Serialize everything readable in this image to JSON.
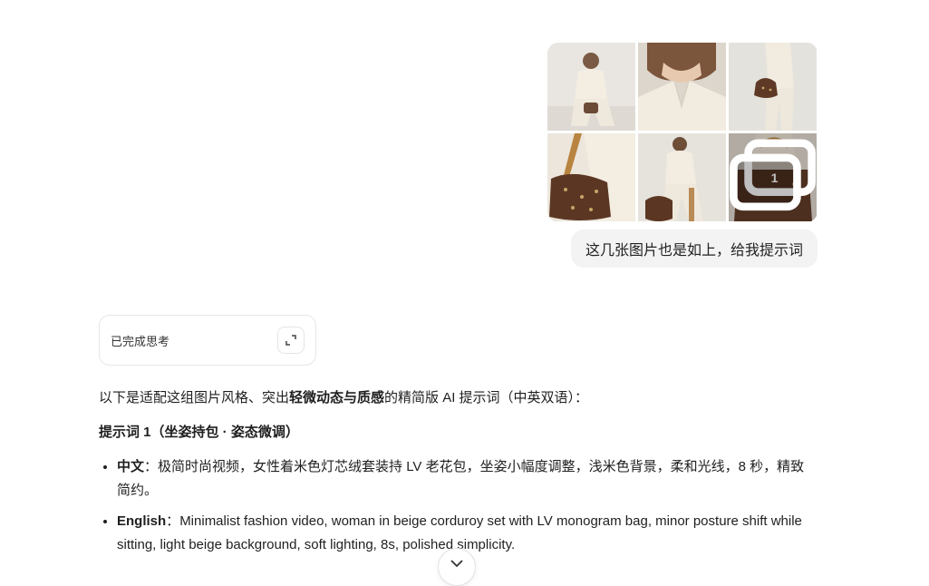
{
  "conversation": {
    "user_message": {
      "images": [
        {
          "icon": "photo-woman-seated-with-bag"
        },
        {
          "icon": "photo-closeup-collar"
        },
        {
          "icon": "photo-bag-on-shoulder"
        },
        {
          "icon": "photo-monogram-bag-closeup"
        },
        {
          "icon": "photo-woman-seated-full"
        },
        {
          "icon": "photo-bag-handles",
          "more_count": "1",
          "more_icon": "gallery-stack-icon"
        }
      ],
      "text": "这几张图片也是如上，给我提示词"
    },
    "thinking": {
      "label": "已完成思考",
      "expand_icon": "expand-icon"
    },
    "answer": {
      "intro_before": "以下是适配这组图片风格、突出",
      "intro_bold": "轻微动态与质感",
      "intro_after": "的精简版 AI 提示词（中英双语）：",
      "heading": "提示词 1（坐姿持包 · 姿态微调）",
      "items": [
        {
          "label": "中文",
          "sep": "：",
          "text": "极简时尚视频，女性着米色灯芯绒套装持 LV 老花包，坐姿小幅度调整，浅米色背景，柔和光线，8 秒，精致简约。"
        },
        {
          "label": "English",
          "sep": "：",
          "text": "Minimalist fashion video, woman in beige corduroy set with LV monogram bag, minor posture shift while sitting, light beige background, soft lighting, 8s, polished simplicity."
        }
      ]
    },
    "scroll_button_icon": "chevron-down-icon"
  },
  "colors": {
    "bubble_bg": "#f3f3f3",
    "border": "#e6e6e6",
    "text": "#1f1f1f"
  }
}
